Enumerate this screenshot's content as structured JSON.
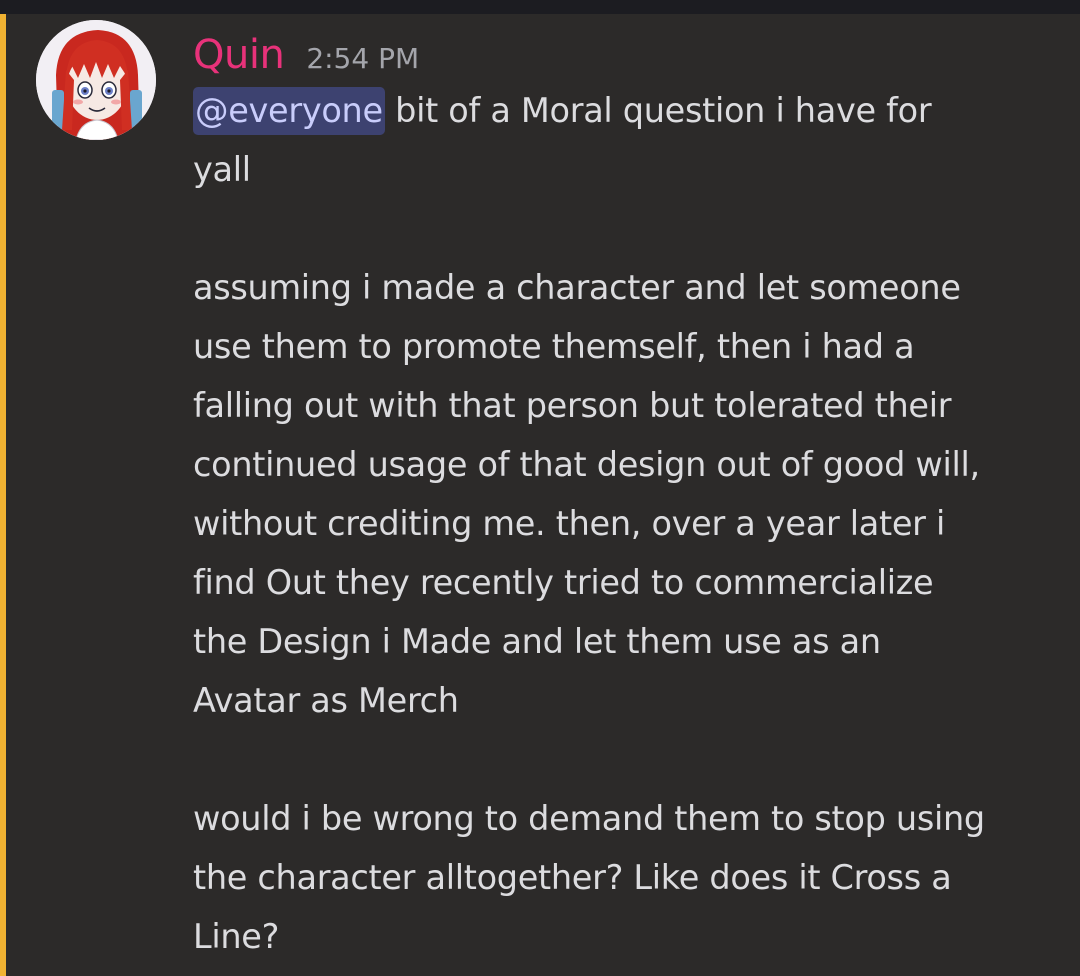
{
  "message": {
    "author": "Quin",
    "timestamp": "2:54 PM",
    "mention": "@everyone",
    "lines": [
      " bit of a Moral question i have for",
      "yall",
      "",
      "assuming i made a character and let someone",
      "use them to promote themself, then i had a",
      "falling out with that person but tolerated their",
      "continued usage of that design out of good will,",
      "without crediting me. then, over a year later i",
      "find Out they recently tried to commercialize",
      "the Design i Made and let them use as an",
      "Avatar as Merch",
      "",
      "would i be wrong to demand them to stop using",
      "the character alltogether? Like does it Cross a",
      "Line?"
    ]
  },
  "colors": {
    "background": "#2c2a29",
    "author": "#e8327a",
    "timestamp": "#a4a5ab",
    "text": "#dcdcdf",
    "mention_bg": "#3d4270",
    "mention_text": "#c9cdfb",
    "highlight_bar": "#f0b232"
  },
  "icons": {
    "avatar": "red-haired-anime-girl-avatar"
  }
}
